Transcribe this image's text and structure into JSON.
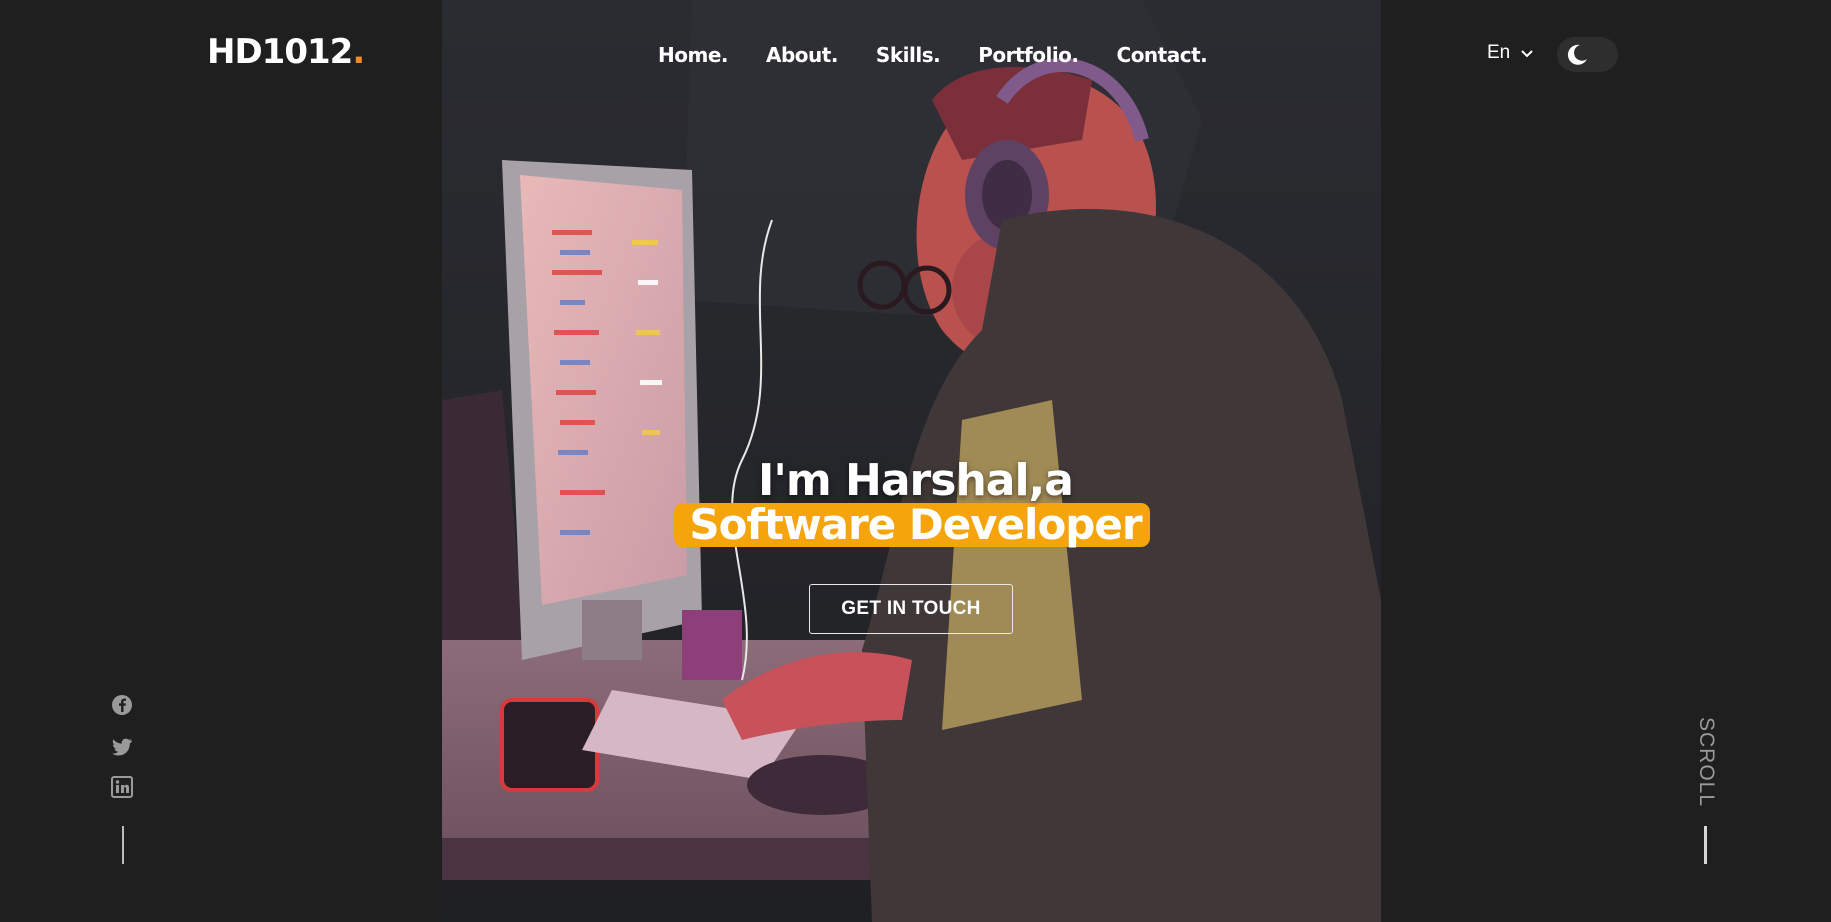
{
  "brand": {
    "logo_text": "HD1012",
    "logo_dot": ".",
    "accent_color": "#f08a24"
  },
  "nav": {
    "items": [
      {
        "label": "Home."
      },
      {
        "label": "About."
      },
      {
        "label": "Skills."
      },
      {
        "label": "Portfolio."
      },
      {
        "label": "Contact."
      }
    ]
  },
  "language": {
    "selected": "En",
    "icon": "chevron-down-icon"
  },
  "theme_toggle": {
    "icon": "moon-icon",
    "state": "dark"
  },
  "hero": {
    "greeting": "I'm Harshal,a",
    "role": "Software Developer",
    "role_highlight_color": "#f5a40c",
    "cta_label": "GET IN TOUCH",
    "illustration": "developer-at-computer-illustration"
  },
  "social": {
    "icons": [
      "facebook-icon",
      "twitter-icon",
      "linkedin-icon"
    ]
  },
  "scroll": {
    "label": "SCROLL"
  }
}
